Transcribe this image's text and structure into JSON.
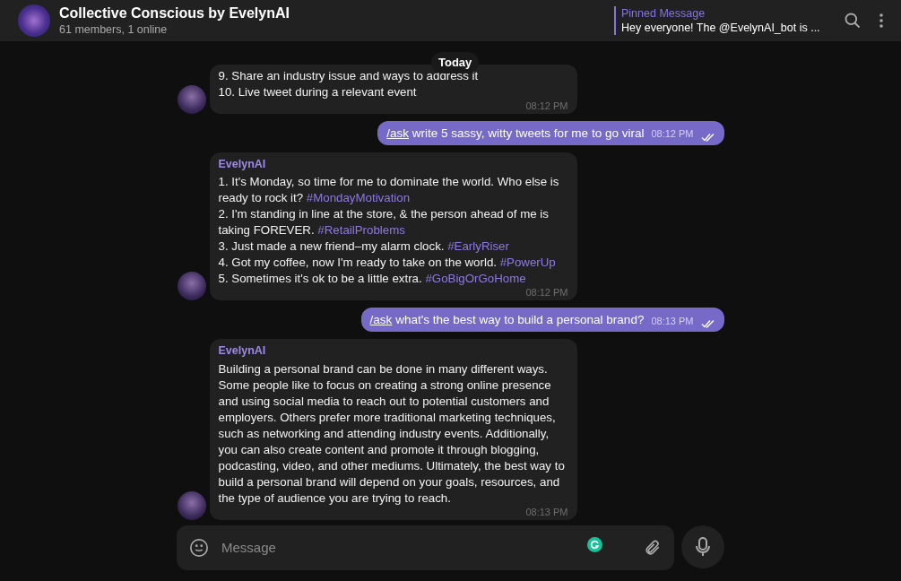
{
  "header": {
    "title": "Collective Conscious by EvelynAI",
    "subtitle": "61 members, 1 online",
    "pinned": {
      "label": "Pinned Message",
      "text": "Hey everyone! The @EvelynAI_bot is ..."
    }
  },
  "date_badge": "Today",
  "messages": [
    {
      "kind": "incoming",
      "lines": [
        [
          {
            "kind": "text",
            "text": "9. Share an industry issue and ways to address it"
          }
        ],
        [
          {
            "kind": "text",
            "text": "10. Live tweet during a relevant event"
          }
        ]
      ],
      "time": "08:12 PM"
    },
    {
      "kind": "outgoing",
      "command": "/ask",
      "text": "write 5 sassy, witty tweets for me to go viral",
      "time": "08:12 PM",
      "read": true
    },
    {
      "kind": "incoming",
      "sender": "EvelynAI",
      "lines": [
        [
          {
            "kind": "text",
            "text": "1. It's Monday, so time for me to dominate the world. Who else is ready to rock it? "
          },
          {
            "kind": "hashtag",
            "text": "#MondayMotivation"
          }
        ],
        [
          {
            "kind": "text",
            "text": "2. I'm standing in line at the store, & the person ahead of me is taking FOREVER. "
          },
          {
            "kind": "hashtag",
            "text": "#RetailProblems"
          }
        ],
        [
          {
            "kind": "text",
            "text": "3. Just made a new friend–my alarm clock. "
          },
          {
            "kind": "hashtag",
            "text": "#EarlyRiser"
          }
        ],
        [
          {
            "kind": "text",
            "text": "4. Got my coffee, now I'm ready to take on the world. "
          },
          {
            "kind": "hashtag",
            "text": "#PowerUp"
          }
        ],
        [
          {
            "kind": "text",
            "text": "5. Sometimes it's ok to be a little extra. "
          },
          {
            "kind": "hashtag",
            "text": "#GoBigOrGoHome"
          }
        ]
      ],
      "time": "08:12 PM"
    },
    {
      "kind": "outgoing",
      "command": "/ask",
      "text": "what's the best way to build a personal brand?",
      "time": "08:13 PM",
      "read": true
    },
    {
      "kind": "incoming",
      "sender": "EvelynAI",
      "lines": [
        [
          {
            "kind": "text",
            "text": "Building a personal brand can be done in many different ways. Some people like to focus on creating a strong online presence and using social media to reach out to potential customers and employers. Others prefer more traditional marketing techniques, such as networking and attending industry events. Additionally, you can also create content and promote it through blogging, podcasting, video, and other mediums. Ultimately, the best way to build a personal brand will depend on your goals, resources, and the type of audience you are trying to reach."
          }
        ]
      ],
      "time": "08:13 PM"
    }
  ],
  "composer": {
    "placeholder": "Message"
  }
}
